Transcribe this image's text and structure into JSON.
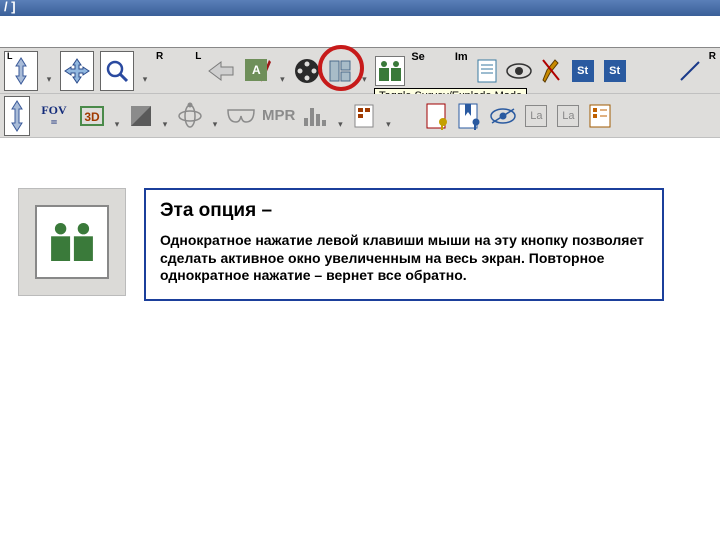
{
  "titlebar": "/ ]",
  "toolbar1": {
    "label_L": "L",
    "label_R": "R",
    "label_A": "A",
    "label_Se": "Se",
    "label_Im": "Im",
    "label_St1": "St",
    "label_St2": "St",
    "tooltip": "Toggle Survey/Explode Mode"
  },
  "toolbar2": {
    "fov_top": "FOV",
    "fov_bottom": "=",
    "label_3D": "3D",
    "label_MPR": "MPR",
    "label_La1": "La",
    "label_La2": "La"
  },
  "description": {
    "title": "Эта опция –",
    "body": "Однократное нажатие левой клавиши мыши на эту кнопку  позволяет сделать активное окно увеличенным на весь экран. Повторное однократное нажатие – вернет все обратно."
  },
  "colors": {
    "ring": "#c71a1a",
    "border": "#1b3f9b",
    "fig_a": "#3c6a3c",
    "fig_b": "#3c6a3c"
  }
}
